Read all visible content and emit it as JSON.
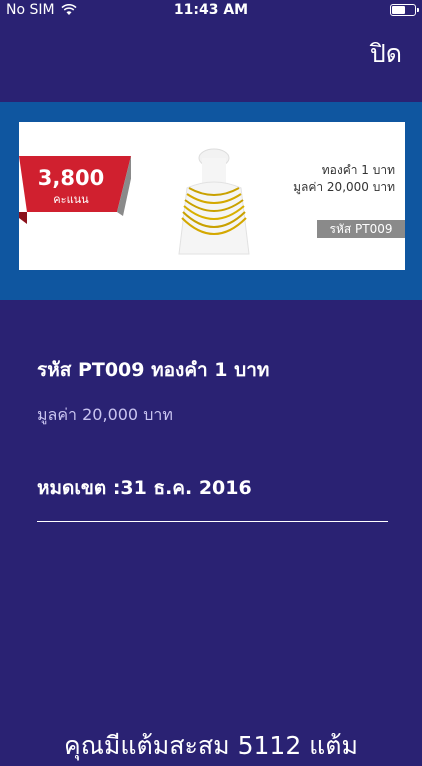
{
  "status_bar": {
    "carrier": "No SIM",
    "time": "11:43 AM"
  },
  "header": {
    "close_label": "ปิด"
  },
  "banner": {
    "points_value": "3,800",
    "points_label": "คะแนน",
    "line1": "ทองคำ 1 บาท",
    "line2": "มูลค่า 20,000 บาท",
    "code_tag": "รหัส PT009"
  },
  "detail": {
    "title": "รหัส PT009 ทองคำ 1 บาท",
    "value": "มูลค่า 20,000 บาท",
    "expiry": "หมดเขต :31 ธ.ค. 2016"
  },
  "footer": {
    "accumulated_text": "คุณมีแต้มสะสม 5112 แต้ม"
  },
  "colors": {
    "background": "#2a2273",
    "banner_strip": "#0f56a0",
    "ribbon": "#d0202f"
  }
}
